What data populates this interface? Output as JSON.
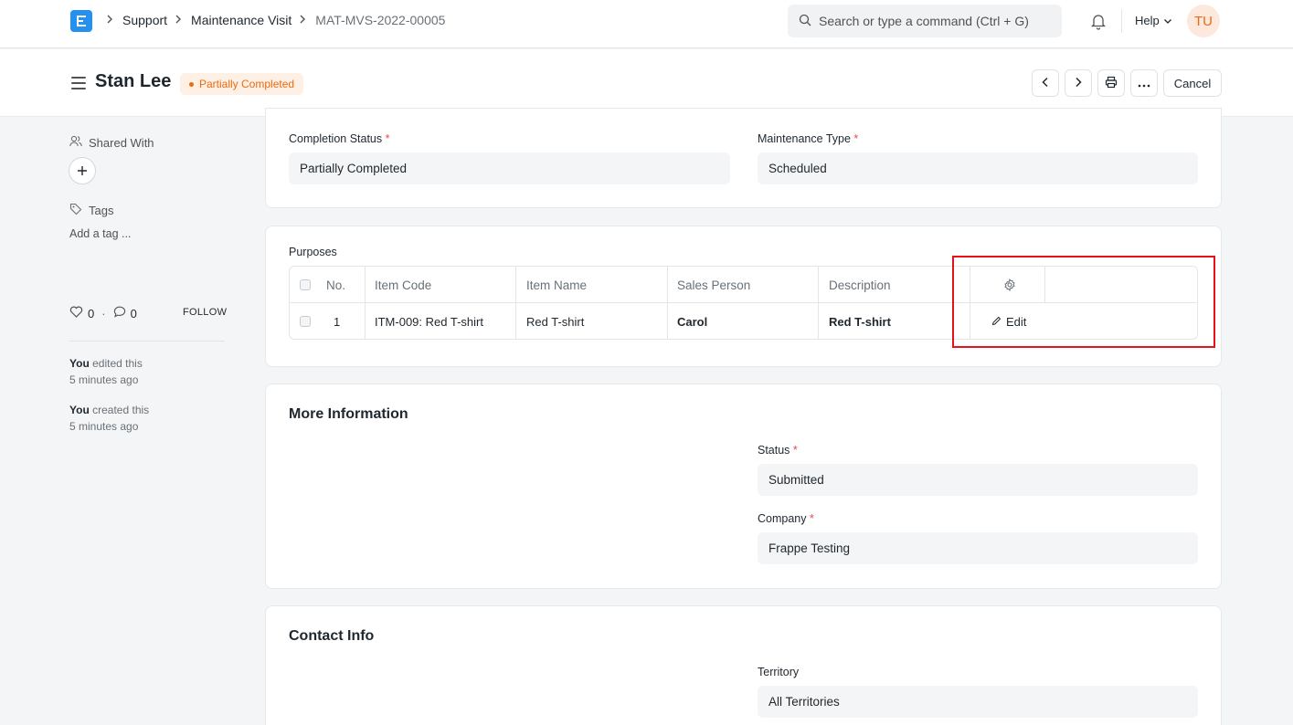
{
  "navbar": {
    "breadcrumbs": [
      "Support",
      "Maintenance Visit",
      "MAT-MVS-2022-00005"
    ],
    "search_placeholder": "Search or type a command (Ctrl + G)",
    "help_label": "Help",
    "avatar_initials": "TU"
  },
  "page": {
    "title": "Stan Lee",
    "status_badge": "Partially Completed",
    "cancel_label": "Cancel"
  },
  "sidebar": {
    "shared_with_label": "Shared With",
    "tags_label": "Tags",
    "add_tag_placeholder": "Add a tag ...",
    "likes_count": "0",
    "comments_count": "0",
    "follow_label": "FOLLOW",
    "activity": [
      {
        "actor": "You",
        "action": "edited this",
        "time": "5 minutes ago"
      },
      {
        "actor": "You",
        "action": "created this",
        "time": "5 minutes ago"
      }
    ]
  },
  "status_section": {
    "completion_status_label": "Completion Status",
    "completion_status_value": "Partially Completed",
    "maintenance_type_label": "Maintenance Type",
    "maintenance_type_value": "Scheduled"
  },
  "purposes": {
    "label": "Purposes",
    "columns": [
      "No.",
      "Item Code",
      "Item Name",
      "Sales Person",
      "Description"
    ],
    "rows": [
      {
        "no": "1",
        "item_code": "ITM-009: Red T-shirt",
        "item_name": "Red T-shirt",
        "sales_person": "Carol",
        "description": "Red T-shirt",
        "edit_label": "Edit"
      }
    ]
  },
  "more_info": {
    "title": "More Information",
    "status_label": "Status",
    "status_value": "Submitted",
    "company_label": "Company",
    "company_value": "Frappe Testing"
  },
  "contact_info": {
    "title": "Contact Info",
    "territory_label": "Territory",
    "territory_value": "All Territories"
  },
  "colors": {
    "accent": "#2490ef",
    "status_orange": "#e86c13",
    "highlight_red": "#e8101a"
  }
}
